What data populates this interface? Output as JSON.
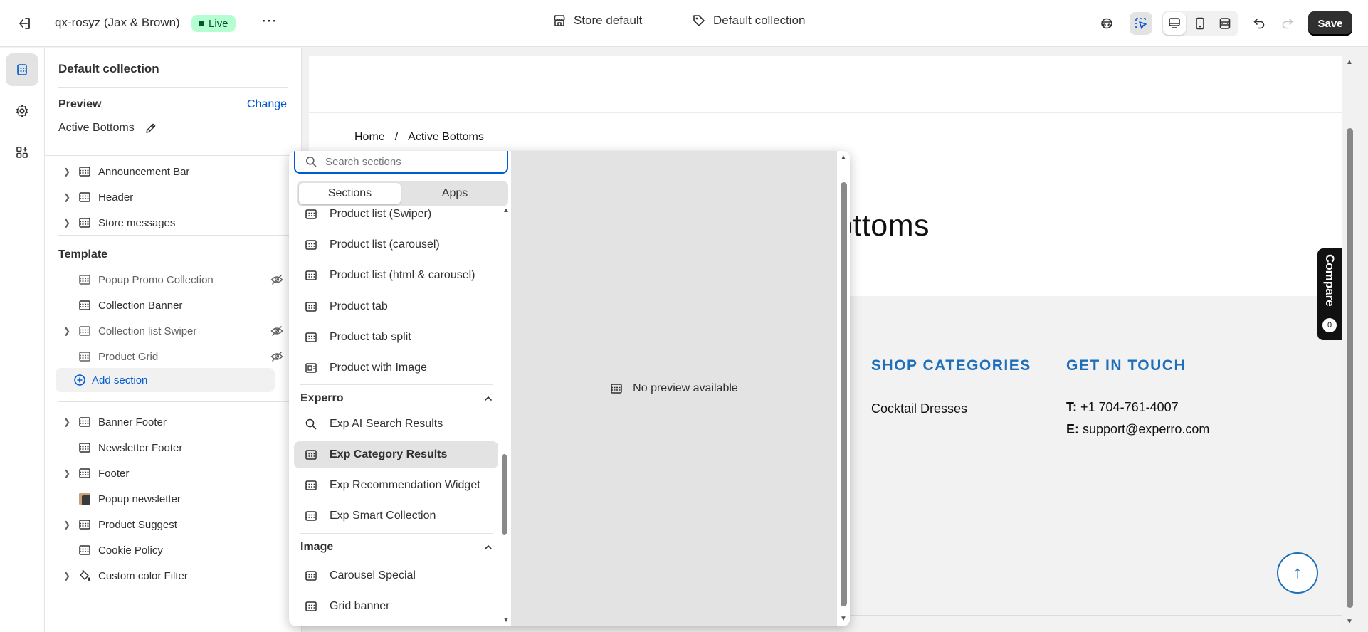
{
  "topbar": {
    "store_name": "qx-rosyz (Jax & Brown)",
    "status": "Live",
    "more": "⋯",
    "theme": "Store default",
    "template": "Default collection",
    "save_label": "Save"
  },
  "sidebar": {
    "title": "Default collection",
    "preview_label": "Preview",
    "change_label": "Change",
    "active_collection": "Active Bottoms",
    "header_group": [
      "Announcement Bar",
      "Header",
      "Store messages"
    ],
    "template_label": "Template",
    "template_items": [
      "Popup Promo Collection",
      "Collection Banner",
      "Collection list Swiper",
      "Product Grid"
    ],
    "add_section": "Add section",
    "footer_group": [
      "Banner Footer",
      "Newsletter Footer",
      "Footer",
      "Popup newsletter",
      "Product Suggest",
      "Cookie Policy",
      "Custom color Filter"
    ]
  },
  "popover": {
    "search_placeholder": "Search sections",
    "tab_sections": "Sections",
    "tab_apps": "Apps",
    "items_top": [
      "Product list (Swiper)",
      "Product list (carousel)",
      "Product list (html & carousel)",
      "Product tab",
      "Product tab split",
      "Product with Image"
    ],
    "group_experro": "Experro",
    "items_experro": [
      "Exp AI Search Results",
      "Exp Category Results",
      "Exp Recommendation Widget",
      "Exp Smart Collection"
    ],
    "group_image": "Image",
    "items_image": [
      "Carousel Special",
      "Grid banner"
    ],
    "no_preview": "No preview available"
  },
  "canvas": {
    "breadcrumb_home": "Home",
    "breadcrumb_sep": "/",
    "breadcrumb_current": "Active Bottoms",
    "title_fragment": "ottoms",
    "shop_categories": "SHOP CATEGORIES",
    "get_in_touch": "GET IN TOUCH",
    "category_1": "Cocktail Dresses",
    "phone_label": "T:",
    "phone": "+1 704-761-4007",
    "email_label": "E:",
    "email": "support@experro.com",
    "compare": "Compare",
    "compare_count": "0"
  },
  "colors": {
    "accent": "#005bd3",
    "live_bg": "#b4fed2",
    "footer_heading": "#1e6fba"
  }
}
